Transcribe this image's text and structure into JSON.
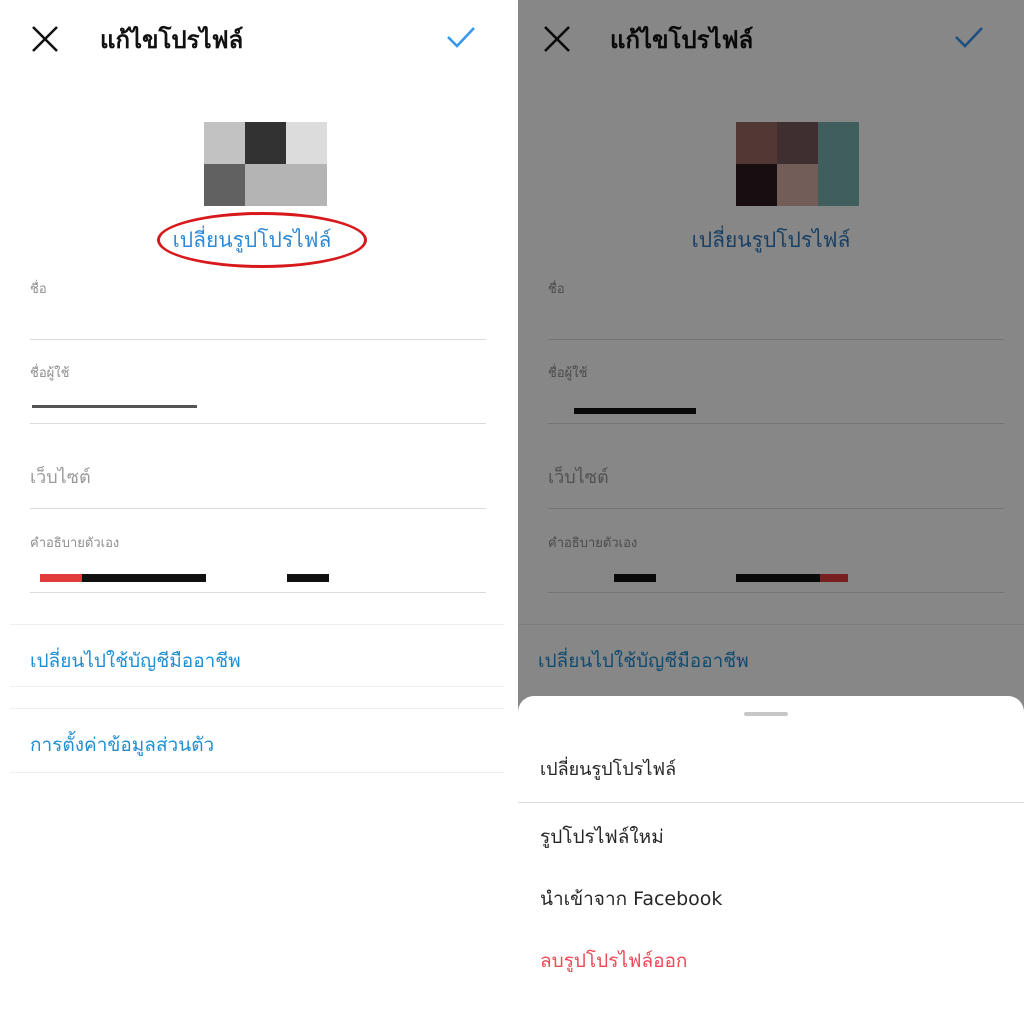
{
  "header": {
    "title": "แก้ไขโปรไฟล์"
  },
  "profile": {
    "change_photo_label": "เปลี่ยนรูปโปรไฟล์"
  },
  "fields": {
    "name_label": "ชื่อ",
    "username_label": "ชื่อผู้ใช้",
    "website_placeholder": "เว็บไซต์",
    "bio_label": "คำอธิบายตัวเอง"
  },
  "links": {
    "switch_pro": "เปลี่ยนไปใช้บัญชีมืออาชีพ",
    "personal_info": "การตั้งค่าข้อมูลส่วนตัว"
  },
  "sheet": {
    "title": "เปลี่ยนรูปโปรไฟล์",
    "items": [
      "รูปโปรไฟล์ใหม่",
      "นำเข้าจาก Facebook",
      "ลบรูปโปรไฟล์ออก"
    ]
  },
  "colors": {
    "link_blue": "#1f8fd4",
    "check_blue": "#3897f0",
    "danger_red": "#ed4956",
    "annotation_red": "#d7191c"
  },
  "icons": {
    "close": "close-icon",
    "confirm": "check-icon"
  }
}
